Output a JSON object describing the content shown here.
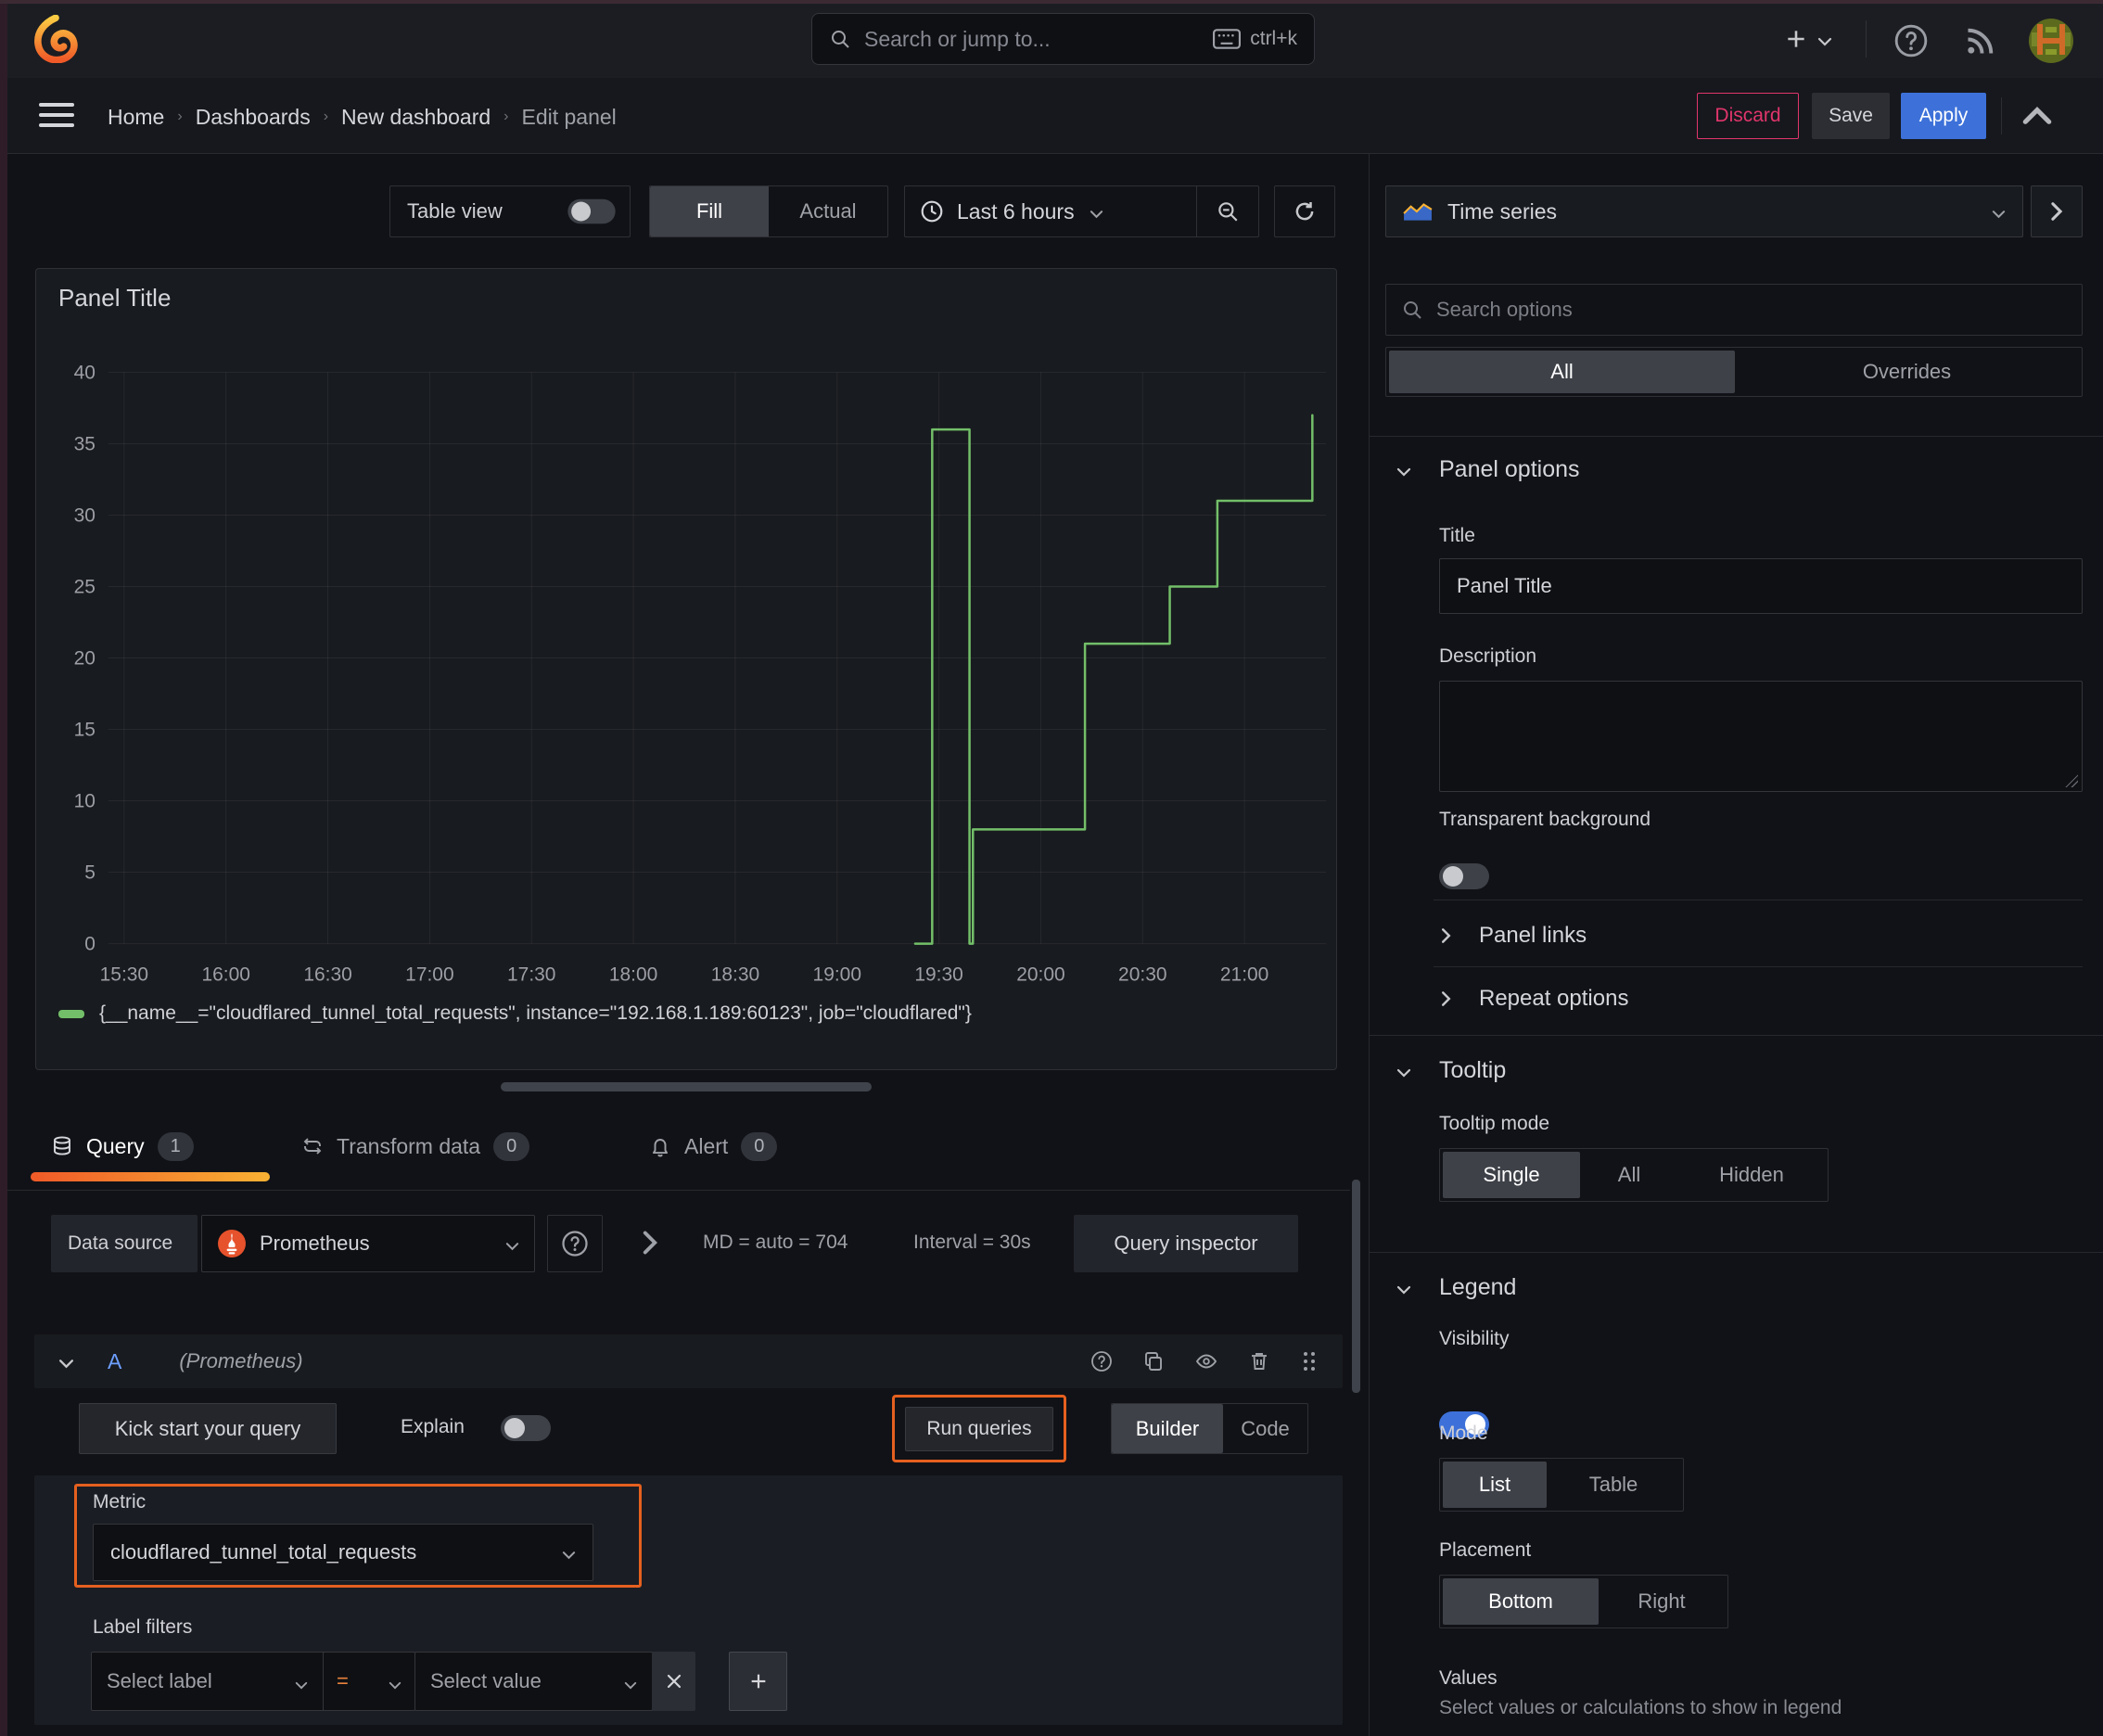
{
  "topbar": {
    "search_placeholder": "Search or jump to...",
    "search_shortcut": "ctrl+k"
  },
  "nav": {
    "breadcrumb": [
      "Home",
      "Dashboards",
      "New dashboard",
      "Edit panel"
    ],
    "discard_label": "Discard",
    "save_label": "Save",
    "apply_label": "Apply"
  },
  "toolbar": {
    "table_view_label": "Table view",
    "fill_label": "Fill",
    "actual_label": "Actual",
    "time_range_label": "Last 6 hours"
  },
  "panel": {
    "title": "Panel Title",
    "legend": "{__name__=\"cloudflared_tunnel_total_requests\", instance=\"192.168.1.189:60123\", job=\"cloudflared\"}"
  },
  "chart_data": {
    "type": "line",
    "title": "Panel Title",
    "xlabel": "",
    "ylabel": "",
    "ylim": [
      0,
      40
    ],
    "y_ticks": [
      0,
      5,
      10,
      15,
      20,
      25,
      30,
      35,
      40
    ],
    "x_ticks": [
      "15:30",
      "16:00",
      "16:30",
      "17:00",
      "17:30",
      "18:00",
      "18:30",
      "19:00",
      "19:30",
      "20:00",
      "20:30",
      "21:00"
    ],
    "grid": true,
    "legend_position": "bottom",
    "series": [
      {
        "name": "{__name__=\"cloudflared_tunnel_total_requests\", instance=\"192.168.1.189:60123\", job=\"cloudflared\"}",
        "color": "#73bf69",
        "points": [
          [
            "19:23",
            0
          ],
          [
            "19:28",
            0
          ],
          [
            "19:28",
            36
          ],
          [
            "19:39",
            36
          ],
          [
            "19:39",
            0
          ],
          [
            "19:40",
            0
          ],
          [
            "19:40",
            8
          ],
          [
            "20:13",
            8
          ],
          [
            "20:13",
            21
          ],
          [
            "20:38",
            21
          ],
          [
            "20:38",
            25
          ],
          [
            "20:52",
            25
          ],
          [
            "20:52",
            31
          ],
          [
            "21:20",
            31
          ],
          [
            "21:20",
            37
          ]
        ]
      }
    ]
  },
  "query": {
    "tabs": [
      {
        "label": "Query",
        "count": "1"
      },
      {
        "label": "Transform data",
        "count": "0"
      },
      {
        "label": "Alert",
        "count": "0"
      }
    ],
    "datasource_label": "Data source",
    "datasource_value": "Prometheus",
    "stats_md": "MD = auto = 704",
    "stats_interval": "Interval = 30s",
    "inspector_label": "Query inspector",
    "ref_id": "A",
    "ref_datasource": "(Prometheus)",
    "kickstart_label": "Kick start your query",
    "explain_label": "Explain",
    "run_label": "Run queries",
    "builder_label": "Builder",
    "code_label": "Code",
    "metric_label": "Metric",
    "metric_value": "cloudflared_tunnel_total_requests",
    "label_filters_label": "Label filters",
    "select_label_placeholder": "Select label",
    "operator_value": "=",
    "select_value_placeholder": "Select value"
  },
  "options": {
    "viz_type": "Time series",
    "search_placeholder": "Search options",
    "tab_all": "All",
    "tab_overrides": "Overrides",
    "panel_options_heading": "Panel options",
    "title_label": "Title",
    "title_value": "Panel Title",
    "description_label": "Description",
    "transparent_label": "Transparent background",
    "panel_links_label": "Panel links",
    "repeat_options_label": "Repeat options",
    "tooltip_heading": "Tooltip",
    "tooltip_mode_label": "Tooltip mode",
    "tooltip_single": "Single",
    "tooltip_all": "All",
    "tooltip_hidden": "Hidden",
    "legend_heading": "Legend",
    "visibility_label": "Visibility",
    "mode_label": "Mode",
    "mode_list": "List",
    "mode_table": "Table",
    "placement_label": "Placement",
    "placement_bottom": "Bottom",
    "placement_right": "Right",
    "values_label": "Values",
    "values_hint": "Select values or calculations to show in legend"
  },
  "colors": {
    "series_green": "#73bf69",
    "highlight_orange": "#e5601f",
    "apply_blue": "#3d71d9",
    "discard_pink": "#e0356b",
    "ref_blue": "#6e9fff",
    "operator_orange": "#e8823d"
  }
}
